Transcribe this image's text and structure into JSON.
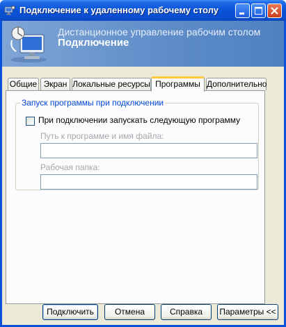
{
  "window": {
    "title": "Подключение к удаленному рабочему столу"
  },
  "banner": {
    "line1": "Дистанционное управление рабочим столом",
    "line2": "Подключение"
  },
  "tabs": [
    {
      "label": "Общие"
    },
    {
      "label": "Экран"
    },
    {
      "label": "Локальные ресурсы"
    },
    {
      "label": "Программы",
      "active": true
    },
    {
      "label": "Дополнительно"
    }
  ],
  "programs": {
    "group_title": "Запуск программы при подключении",
    "checkbox_label": "При подключении запускать следующую программу",
    "checkbox_checked": false,
    "path_label": "Путь к программе и имя файла:",
    "path_value": "",
    "folder_label": "Рабочая папка:",
    "folder_value": ""
  },
  "buttons": {
    "connect": "Подключить",
    "cancel": "Отмена",
    "help": "Справка",
    "options": "Параметры <<"
  },
  "icons": {
    "title": "remote-desktop-icon",
    "banner": "remote-desktop-computer-icon",
    "minimize": "minimize-icon",
    "maximize": "maximize-icon",
    "close": "close-icon"
  }
}
